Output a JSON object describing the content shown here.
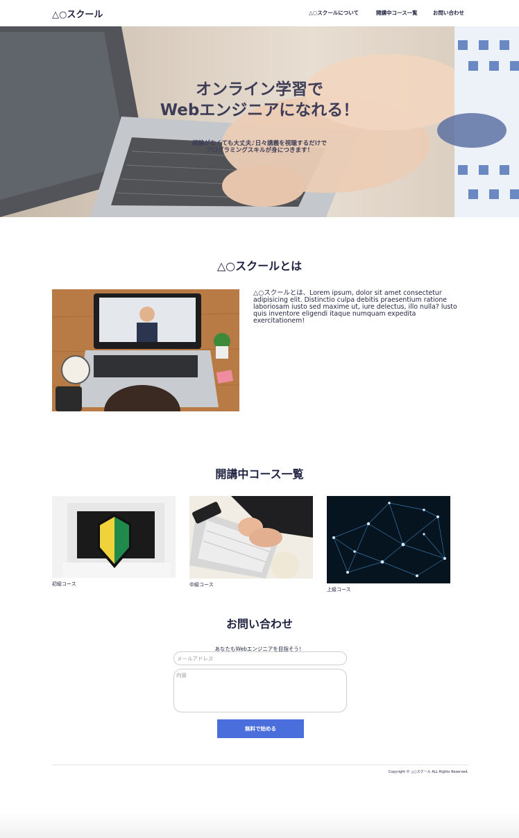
{
  "header": {
    "logo": "△○スクール",
    "nav": [
      "△○スクールについて",
      "開講中コース一覧",
      "お問い合わせ"
    ]
  },
  "hero": {
    "title_line1": "オンライン学習で",
    "title_line2": "Webエンジニアになれる！",
    "sub_line1": "経験がなくても大丈夫♪日々講義を視聴するだけで",
    "sub_line2": "プログラミングスキルが身につきます！"
  },
  "about": {
    "title": "△○スクールとは",
    "text": "△○スクールとは、Lorem ipsum, dolor sit amet consectetur adipisicing elit. Distinctio culpa debitis praesentium ratione laboriosam iusto sed maxime ut, iure delectus, illo nulla? lusto quis inventore eligendi itaque numquam expedita exercitationem!"
  },
  "courses": {
    "title": "開講中コース一覧",
    "items": [
      {
        "label": "初級コース"
      },
      {
        "label": "中級コース"
      },
      {
        "label": "上級コース"
      }
    ]
  },
  "contact": {
    "title": "お問い合わせ",
    "lead": "あなたもWebエンジニアを目指そう！",
    "email_placeholder": "メールアドレス",
    "message_placeholder": "内容",
    "submit_label": "無料で始める"
  },
  "footer": {
    "copyright": "Copyright © △○スクール ALL Rights Reserved."
  },
  "colors": {
    "text": "#1f2240",
    "button": "#4a6fdc"
  }
}
